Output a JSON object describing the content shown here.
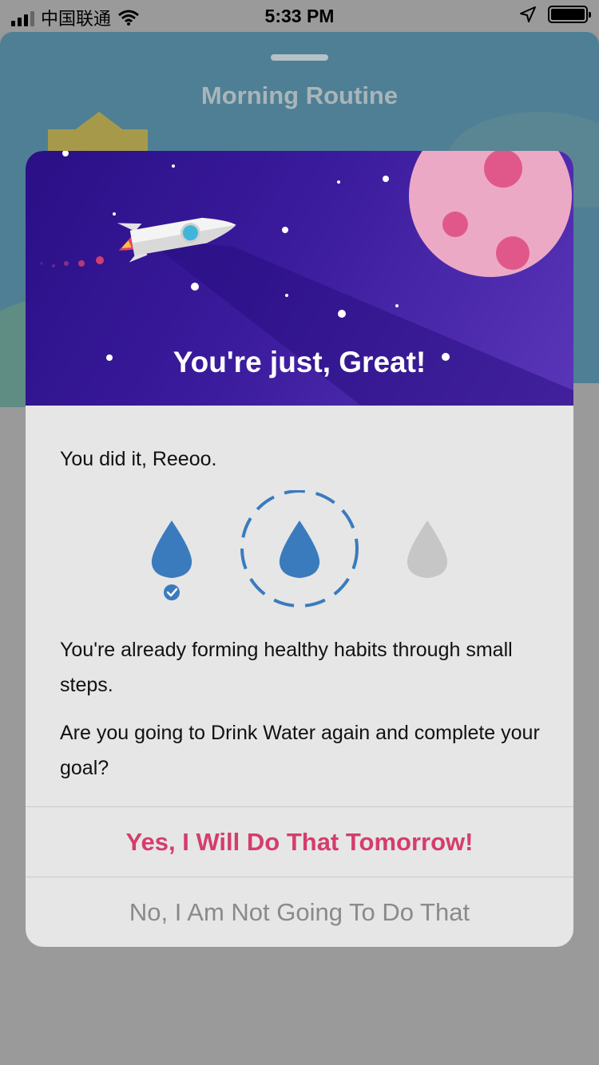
{
  "status_bar": {
    "carrier": "中国联通",
    "time": "5:33 PM"
  },
  "sheet": {
    "title": "Morning Routine"
  },
  "modal": {
    "headline": "You're just, Great!",
    "greeting": "You did it, Reeoo.",
    "progress": {
      "completed": 1,
      "current": 2,
      "total": 3
    },
    "message": "You're already forming healthy habits through small steps.",
    "question": "Are you going to Drink Water again and complete your goal?",
    "confirm_label": "Yes, I Will Do That Tomorrow!",
    "decline_label": "No, I Am Not Going To Do That"
  },
  "colors": {
    "accent_pink": "#d43d6c",
    "drop_blue": "#3a7bbd",
    "drop_gray": "#c6c6c6",
    "hero_purple": "#2a0f86"
  }
}
